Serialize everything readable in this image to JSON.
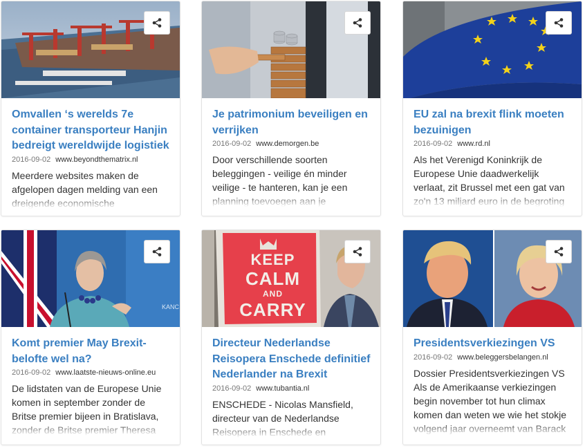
{
  "share_icon": "share-icon",
  "cards": [
    {
      "title": "Omvallen ‘s werelds 7e container transporteur Hanjin bedreigt wereldwijde logistiek",
      "date": "2016-09-02",
      "source": "www.beyondthematrix.nl",
      "excerpt": "Meerdere websites maken de afgelopen dagen melding van een dreigende economische",
      "image": "container-port"
    },
    {
      "title": "Je patrimonium beveiligen en verrijken",
      "date": "2016-09-02",
      "source": "www.demorgen.be",
      "excerpt": "Door verschillende soorten beleggingen - veilige én minder veilige - te hanteren, kan je een planning toevoegen aan je",
      "image": "block-tower-coins"
    },
    {
      "title": "EU zal na brexit flink moeten bezuinigen",
      "date": "2016-09-02",
      "source": "www.rd.nl",
      "excerpt": "Als het Verenigd Koninkrijk de Europese Unie daadwerkelijk verlaat, zit Brussel met een gat van zo'n 13 miljard euro in de begroting",
      "image": "eu-flag"
    },
    {
      "title": "Komt premier May Brexit-belofte wel na?",
      "date": "2016-09-02",
      "source": "www.laatste-nieuws-online.eu",
      "excerpt": "De lidstaten van de Europese Unie komen in september zonder de Britse premier bijeen in Bratislava, zonder de Britse premier Theresa",
      "image": "theresa-may"
    },
    {
      "title": "Directeur Nederlandse Reisopera Enschede definitief Nederlander na Brexit",
      "date": "2016-09-02",
      "source": "www.tubantia.nl",
      "excerpt": "ENSCHEDE - Nicolas Mansfield, directeur van de Nederlandse Reisopera in Enschede en",
      "image": "keep-calm-poster",
      "poster_lines": [
        "KEEP",
        "CALM",
        "AND",
        "CARRY"
      ]
    },
    {
      "title": "Presidentsverkiezingen VS",
      "date": "2016-09-02",
      "source": "www.beleggersbelangen.nl",
      "excerpt": "Dossier Presidentsverkiezingen VS Als de Amerikaanse verkiezingen begin november tot hun climax komen dan weten we wie het stokje volgend jaar overneemt van Barack",
      "image": "trump-clinton"
    }
  ]
}
